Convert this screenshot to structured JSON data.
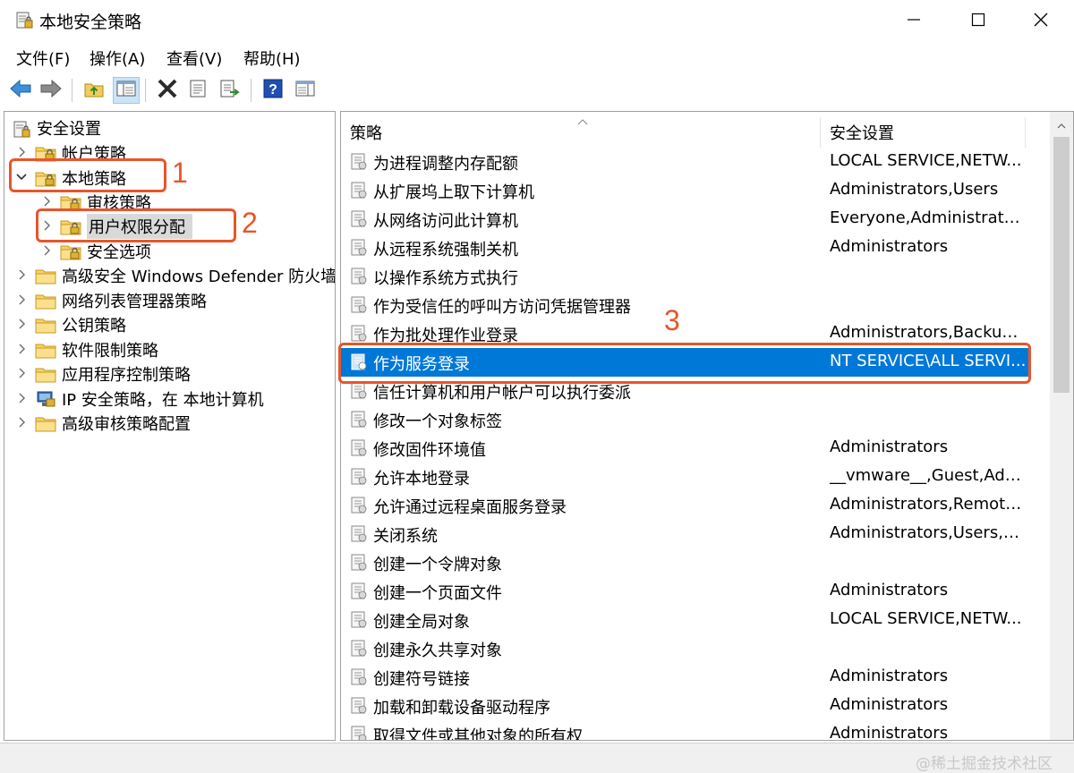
{
  "window": {
    "title": "本地安全策略",
    "controls": [
      "minimize-icon",
      "maximize-icon",
      "close-icon"
    ]
  },
  "menu": [
    "文件(F)",
    "操作(A)",
    "查看(V)",
    "帮助(H)"
  ],
  "toolbar": {
    "icons": [
      "back-arrow-icon",
      "forward-arrow-icon",
      "up-folder-icon",
      "show-hide-tree-icon",
      "delete-icon",
      "properties-icon",
      "export-list-icon",
      "help-icon",
      "view-icon"
    ]
  },
  "tree": {
    "root": "安全设置",
    "items": [
      {
        "label": "帐户策略",
        "level": 1,
        "expanded": false,
        "selected": false
      },
      {
        "label": "本地策略",
        "level": 1,
        "expanded": true,
        "selected": false
      },
      {
        "label": "审核策略",
        "level": 2,
        "expanded": false,
        "selected": false
      },
      {
        "label": "用户权限分配",
        "level": 2,
        "expanded": false,
        "selected": true
      },
      {
        "label": "安全选项",
        "level": 2,
        "expanded": false,
        "selected": false
      },
      {
        "label": "高级安全 Windows Defender 防火墙",
        "level": 1,
        "expanded": false,
        "selected": false
      },
      {
        "label": "网络列表管理器策略",
        "level": 1,
        "expanded": false,
        "selected": false
      },
      {
        "label": "公钥策略",
        "level": 1,
        "expanded": false,
        "selected": false
      },
      {
        "label": "软件限制策略",
        "level": 1,
        "expanded": false,
        "selected": false
      },
      {
        "label": "应用程序控制策略",
        "level": 1,
        "expanded": false,
        "selected": false
      },
      {
        "label": "IP 安全策略，在 本地计算机",
        "level": 1,
        "expanded": false,
        "selected": false
      },
      {
        "label": "高级审核策略配置",
        "level": 1,
        "expanded": false,
        "selected": false
      }
    ]
  },
  "list": {
    "columns": [
      "策略",
      "安全设置"
    ],
    "rows": [
      {
        "name": "为进程调整内存配额",
        "value": "LOCAL SERVICE,NETW..."
      },
      {
        "name": "从扩展坞上取下计算机",
        "value": "Administrators,Users"
      },
      {
        "name": "从网络访问此计算机",
        "value": "Everyone,Administrator..."
      },
      {
        "name": "从远程系统强制关机",
        "value": "Administrators"
      },
      {
        "name": "以操作系统方式执行",
        "value": ""
      },
      {
        "name": "作为受信任的呼叫方访问凭据管理器",
        "value": ""
      },
      {
        "name": "作为批处理作业登录",
        "value": "Administrators,Backup ..."
      },
      {
        "name": "作为服务登录",
        "value": "NT SERVICE\\ALL SERVI...",
        "selected": true
      },
      {
        "name": "信任计算机和用户帐户可以执行委派",
        "value": ""
      },
      {
        "name": "修改一个对象标签",
        "value": ""
      },
      {
        "name": "修改固件环境值",
        "value": "Administrators"
      },
      {
        "name": "允许本地登录",
        "value": "__vmware__,Guest,Adm..."
      },
      {
        "name": "允许通过远程桌面服务登录",
        "value": "Administrators,Remote ..."
      },
      {
        "name": "关闭系统",
        "value": "Administrators,Users,Ba..."
      },
      {
        "name": "创建一个令牌对象",
        "value": ""
      },
      {
        "name": "创建一个页面文件",
        "value": "Administrators"
      },
      {
        "name": "创建全局对象",
        "value": "LOCAL SERVICE,NETW..."
      },
      {
        "name": "创建永久共享对象",
        "value": ""
      },
      {
        "name": "创建符号链接",
        "value": "Administrators"
      },
      {
        "name": "加载和卸载设备驱动程序",
        "value": "Administrators"
      },
      {
        "name": "取得文件或其他对象的所有权",
        "value": "Administrators"
      }
    ]
  },
  "annotations": [
    "1",
    "2",
    "3"
  ],
  "watermark": "@稀土掘金技术社区",
  "colors": {
    "selection": "#0078d7",
    "annotation": "#e8552a",
    "tree_selected": "#d9d9d9"
  }
}
